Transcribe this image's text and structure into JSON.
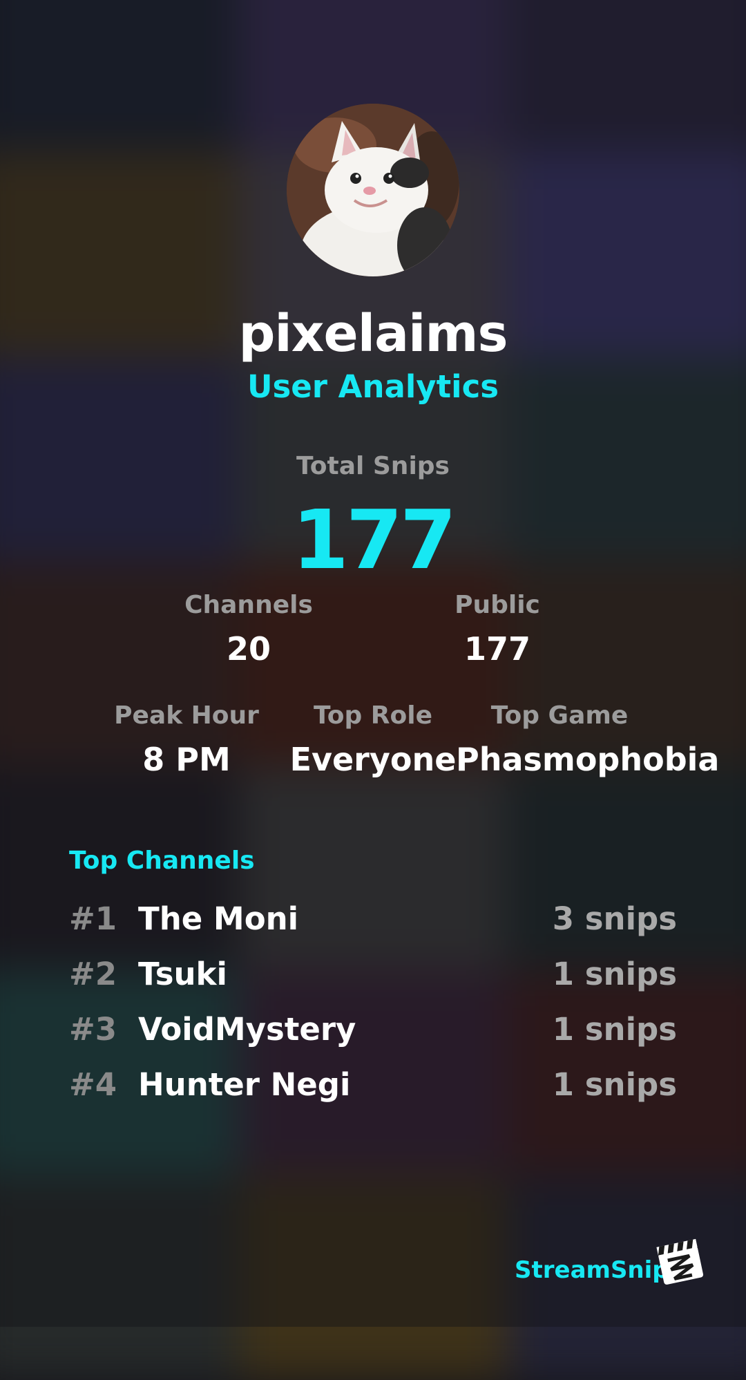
{
  "profile": {
    "avatar_icon": "cat-avatar",
    "username": "pixelaims",
    "subtitle": "User Analytics"
  },
  "stats": {
    "total_snips_label": "Total Snips",
    "total_snips_value": "177",
    "channels_label": "Channels",
    "channels_value": "20",
    "public_label": "Public",
    "public_value": "177",
    "peak_hour_label": "Peak Hour",
    "peak_hour_value": "8 PM",
    "top_role_label": "Top Role",
    "top_role_value": "Everyone",
    "top_game_label": "Top Game",
    "top_game_value": "Phasmophobia"
  },
  "top_channels": {
    "title": "Top Channels",
    "items": [
      {
        "rank": "#1",
        "name": "The Moni",
        "count": "3 snips"
      },
      {
        "rank": "#2",
        "name": "Tsuki",
        "count": "1 snips"
      },
      {
        "rank": "#3",
        "name": "VoidMystery",
        "count": "1 snips"
      },
      {
        "rank": "#4",
        "name": "Hunter Negi",
        "count": "1 snips"
      }
    ]
  },
  "brand": {
    "name": "StreamSnip",
    "logo_icon": "clapperboard-logo-icon"
  },
  "colors": {
    "accent": "#17e8f3",
    "label_gray": "#9c9c9c",
    "text_white": "#ffffff"
  }
}
